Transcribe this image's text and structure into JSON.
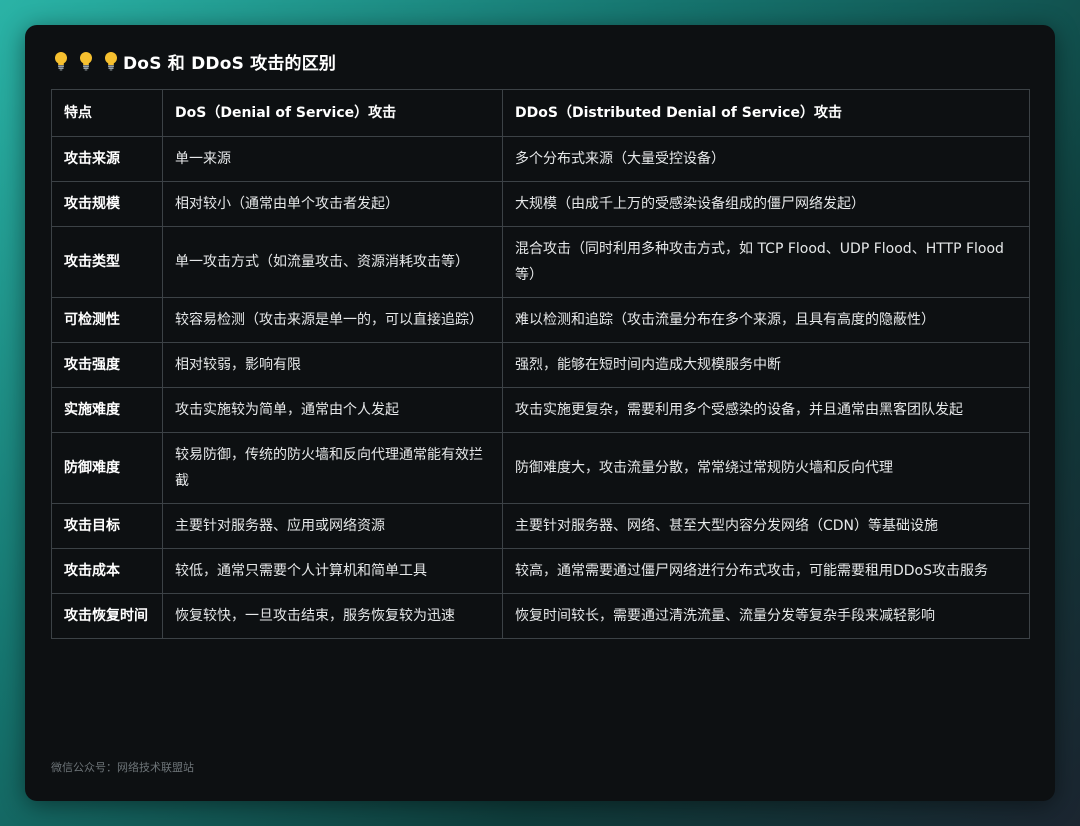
{
  "title": "DoS 和 DDoS 攻击的区别",
  "icons": [
    "lightbulb-icon",
    "lightbulb-icon",
    "lightbulb-icon"
  ],
  "colors": {
    "bulb": "#f6c02f",
    "background": "#0d1012",
    "border": "#3c4246"
  },
  "table": {
    "headers": [
      "特点",
      "DoS（Denial of Service）攻击",
      "DDoS（Distributed Denial of Service）攻击"
    ],
    "rows": [
      {
        "feature": "攻击来源",
        "dos": "单一来源",
        "ddos": "多个分布式来源（大量受控设备）"
      },
      {
        "feature": "攻击规模",
        "dos": "相对较小（通常由单个攻击者发起）",
        "ddos": "大规模（由成千上万的受感染设备组成的僵尸网络发起）"
      },
      {
        "feature": "攻击类型",
        "dos": "单一攻击方式（如流量攻击、资源消耗攻击等）",
        "ddos": "混合攻击（同时利用多种攻击方式，如 TCP Flood、UDP Flood、HTTP Flood等）"
      },
      {
        "feature": "可检测性",
        "dos": "较容易检测（攻击来源是单一的，可以直接追踪）",
        "ddos": "难以检测和追踪（攻击流量分布在多个来源，且具有高度的隐蔽性）"
      },
      {
        "feature": "攻击强度",
        "dos": "相对较弱，影响有限",
        "ddos": "强烈，能够在短时间内造成大规模服务中断"
      },
      {
        "feature": "实施难度",
        "dos": "攻击实施较为简单，通常由个人发起",
        "ddos": "攻击实施更复杂，需要利用多个受感染的设备，并且通常由黑客团队发起"
      },
      {
        "feature": "防御难度",
        "dos": "较易防御，传统的防火墙和反向代理通常能有效拦截",
        "ddos": "防御难度大，攻击流量分散，常常绕过常规防火墙和反向代理"
      },
      {
        "feature": "攻击目标",
        "dos": "主要针对服务器、应用或网络资源",
        "ddos": "主要针对服务器、网络、甚至大型内容分发网络（CDN）等基础设施"
      },
      {
        "feature": "攻击成本",
        "dos": "较低，通常只需要个人计算机和简单工具",
        "ddos": "较高，通常需要通过僵尸网络进行分布式攻击，可能需要租用DDoS攻击服务"
      },
      {
        "feature": "攻击恢复时间",
        "dos": "恢复较快，一旦攻击结束，服务恢复较为迅速",
        "ddos": "恢复时间较长，需要通过清洗流量、流量分发等复杂手段来减轻影响"
      }
    ]
  },
  "footer": "微信公众号：网络技术联盟站"
}
